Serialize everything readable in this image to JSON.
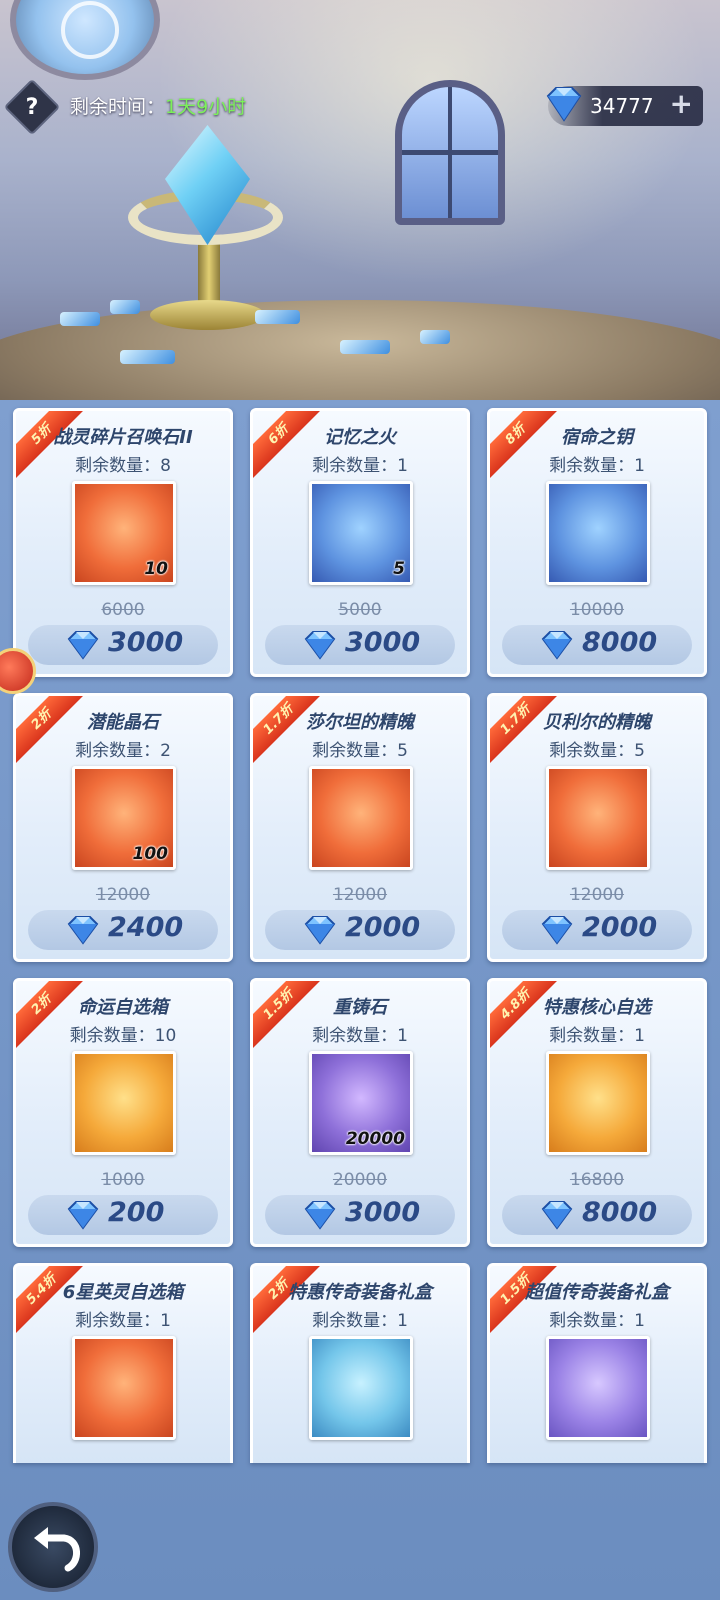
{
  "header": {
    "help_label": "?",
    "timer_label": "剩余时间：",
    "timer_value": "1天9小时",
    "currency_amount": "34777",
    "currency_plus": "+",
    "currency_icon": "diamond-icon"
  },
  "items": [
    {
      "discount": "5折",
      "name": "战灵碎片召唤石II",
      "qty": "剩余数量：8",
      "icon_count": "10",
      "original": "6000",
      "price": "3000",
      "icon": "summon-stone-icon",
      "bg": "bg-orange"
    },
    {
      "discount": "6折",
      "name": "记忆之火",
      "qty": "剩余数量：1",
      "icon_count": "5",
      "original": "5000",
      "price": "3000",
      "icon": "flame-icon",
      "bg": "bg-blue"
    },
    {
      "discount": "8折",
      "name": "宿命之钥",
      "qty": "剩余数量：1",
      "icon_count": "",
      "original": "10000",
      "price": "8000",
      "icon": "key-icon",
      "bg": "bg-blue"
    },
    {
      "discount": "2折",
      "name": "潜能晶石",
      "qty": "剩余数量：2",
      "icon_count": "100",
      "original": "12000",
      "price": "2400",
      "icon": "star-crystal-icon",
      "bg": "bg-orange"
    },
    {
      "discount": "1.7折",
      "name": "莎尔坦的精魄",
      "qty": "剩余数量：5",
      "icon_count": "",
      "original": "12000",
      "price": "2000",
      "icon": "purple-orb-icon",
      "bg": "bg-orange"
    },
    {
      "discount": "1.7折",
      "name": "贝利尔的精魄",
      "qty": "剩余数量：5",
      "icon_count": "",
      "original": "12000",
      "price": "2000",
      "icon": "red-orb-icon",
      "bg": "bg-orange"
    },
    {
      "discount": "2折",
      "name": "命运自选箱",
      "qty": "剩余数量：10",
      "icon_count": "",
      "original": "1000",
      "price": "200",
      "icon": "chest-icon",
      "bg": "bg-gold"
    },
    {
      "discount": "1.5折",
      "name": "重铸石",
      "qty": "剩余数量：1",
      "icon_count": "20000",
      "original": "20000",
      "price": "3000",
      "icon": "reforge-stone-icon",
      "bg": "bg-purple"
    },
    {
      "discount": "4.8折",
      "name": "特惠核心自选",
      "qty": "剩余数量：1",
      "icon_count": "",
      "original": "16800",
      "price": "8000",
      "icon": "card-icon",
      "bg": "bg-gold"
    },
    {
      "discount": "5.4折",
      "name": "6星英灵自选箱",
      "qty": "剩余数量：1",
      "icon_count": "",
      "original": "",
      "price": "",
      "icon": "hero-chest-icon",
      "bg": "bg-orange"
    },
    {
      "discount": "2折",
      "name": "特惠传奇装备礼盒",
      "qty": "剩余数量：1",
      "icon_count": "",
      "original": "",
      "price": "",
      "icon": "armor-box-icon",
      "bg": "bg-cyan"
    },
    {
      "discount": "1.5折",
      "name": "超值传奇装备礼盒",
      "qty": "剩余数量：1",
      "icon_count": "",
      "original": "",
      "price": "",
      "icon": "armor-box-gold-icon",
      "bg": "bg-violet"
    }
  ],
  "nav": {
    "back_icon": "back-arrow-icon",
    "side_icon": "parrot-icon"
  },
  "colors": {
    "timer_value": "#7cf05a",
    "ribbon": "#e8472a",
    "price_text": "#2b4a86",
    "diamond": "#2f74d8"
  }
}
